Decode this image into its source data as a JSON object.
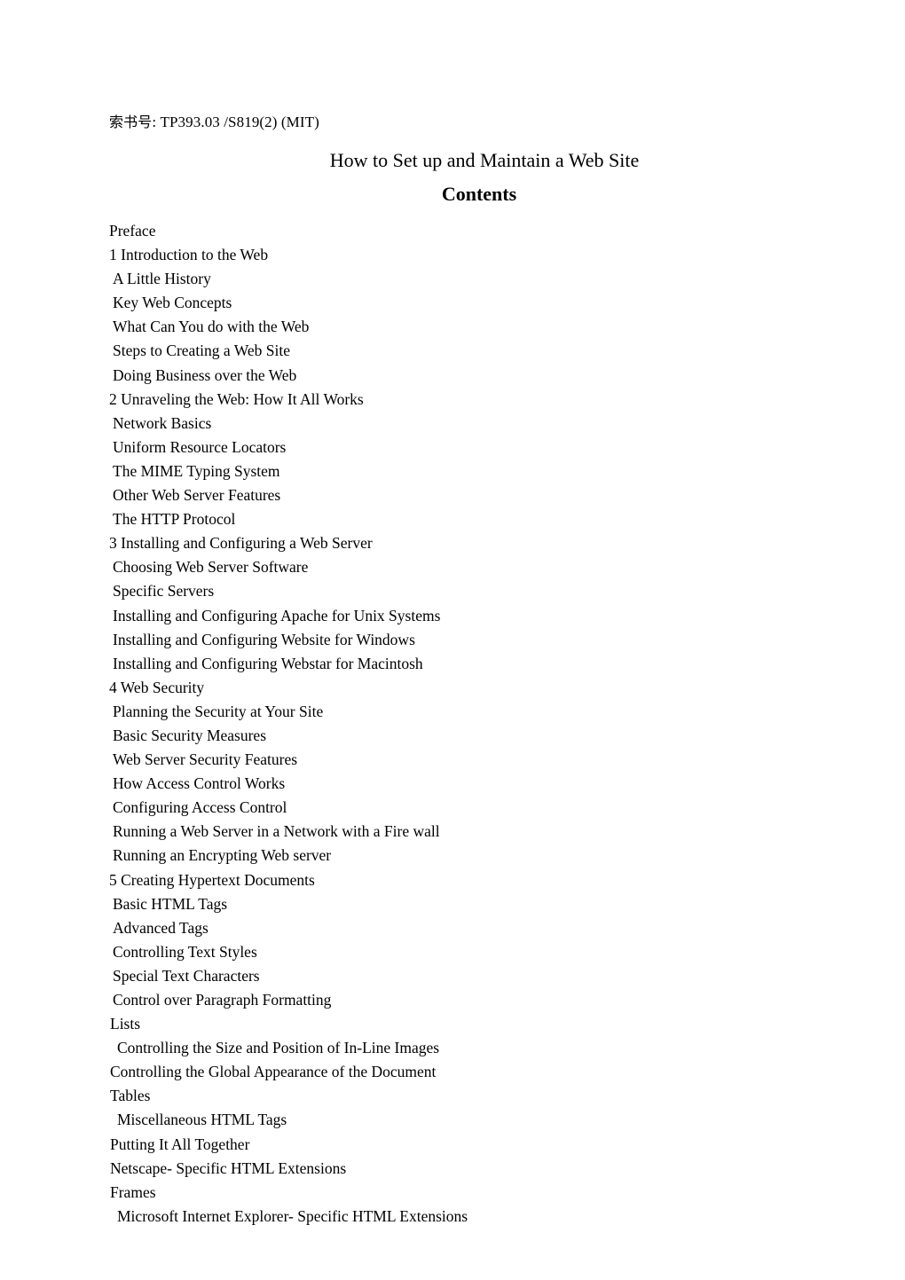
{
  "header": {
    "call_number_label": "索书号",
    "call_number_separator": ": ",
    "call_number_value": "TP393.03 /S819(2) (MIT)",
    "call_number_full": "索书号: TP393.03 /S819(2) (MIT)",
    "book_title": "How to Set up and Maintain a Web Site",
    "contents_heading": "Contents"
  },
  "toc": {
    "entries": [
      {
        "text": "Preface",
        "level": "chapter"
      },
      {
        "text": "1 Introduction to the Web",
        "level": "chapter"
      },
      {
        "text": "A Little History",
        "level": "section"
      },
      {
        "text": "Key Web Concepts",
        "level": "section"
      },
      {
        "text": "What Can You do with the Web",
        "level": "section"
      },
      {
        "text": "Steps to Creating a Web Site",
        "level": "section"
      },
      {
        "text": "Doing Business over the Web",
        "level": "section"
      },
      {
        "text": "2 Unraveling the Web: How It All Works",
        "level": "chapter"
      },
      {
        "text": "Network Basics",
        "level": "section"
      },
      {
        "text": "Uniform Resource Locators",
        "level": "section"
      },
      {
        "text": "The MIME Typing System",
        "level": "section"
      },
      {
        "text": "Other Web Server Features",
        "level": "section"
      },
      {
        "text": "The HTTP Protocol",
        "level": "section"
      },
      {
        "text": "3 Installing and Configuring a Web Server",
        "level": "chapter"
      },
      {
        "text": "Choosing Web Server Software",
        "level": "section"
      },
      {
        "text": "Specific Servers",
        "level": "section"
      },
      {
        "text": "Installing and Configuring Apache for Unix Systems",
        "level": "section"
      },
      {
        "text": "Installing and Configuring Website for Windows",
        "level": "section"
      },
      {
        "text": "Installing and Configuring Webstar for Macintosh",
        "level": "section"
      },
      {
        "text": "4 Web Security",
        "level": "chapter"
      },
      {
        "text": "Planning the Security at Your Site",
        "level": "section"
      },
      {
        "text": "Basic Security Measures",
        "level": "section"
      },
      {
        "text": "Web Server Security Features",
        "level": "section"
      },
      {
        "text": "How Access Control Works",
        "level": "section"
      },
      {
        "text": "Configuring Access Control",
        "level": "section"
      },
      {
        "text": "Running a Web Server in a Network with a Fire wall",
        "level": "section"
      },
      {
        "text": "Running an Encrypting Web server",
        "level": "section"
      },
      {
        "text": "5 Creating Hypertext Documents",
        "level": "chapter"
      },
      {
        "text": "Basic HTML Tags",
        "level": "section"
      },
      {
        "text": "Advanced Tags",
        "level": "section"
      },
      {
        "text": "Controlling Text Styles",
        "level": "section"
      },
      {
        "text": "Special Text Characters",
        "level": "section"
      },
      {
        "text": "Control over Paragraph Formatting",
        "level": "section"
      },
      {
        "text": "Lists",
        "level": "flush"
      },
      {
        "text": "Controlling the Size and Position of In-Line Images",
        "level": "section-wide"
      },
      {
        "text": "Controlling the Global Appearance of the Document",
        "level": "flush"
      },
      {
        "text": "Tables",
        "level": "flush"
      },
      {
        "text": "Miscellaneous HTML Tags",
        "level": "section-wide"
      },
      {
        "text": "Putting It All Together",
        "level": "flush"
      },
      {
        "text": "Netscape- Specific HTML Extensions",
        "level": "flush"
      },
      {
        "text": "Frames",
        "level": "flush"
      },
      {
        "text": "Microsoft Internet Explorer- Specific HTML Extensions",
        "level": "section-wide"
      }
    ]
  },
  "style": {
    "text_color": "#000000",
    "page_background": "#ffffff"
  }
}
